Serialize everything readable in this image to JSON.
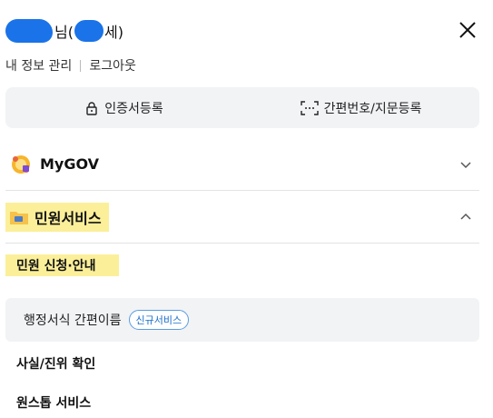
{
  "user": {
    "name_suffix": "님(",
    "name_suffix2": "세)"
  },
  "account": {
    "my_info": "내 정보 관리",
    "logout": "로그아웃"
  },
  "certificate": {
    "cert_register": "인증서등록",
    "pin_register": "간편번호/지문등록"
  },
  "menu": {
    "mygov": {
      "label": "MyGOV",
      "state": "collapsed"
    },
    "minwon": {
      "label": "민원서비스",
      "state": "expanded"
    }
  },
  "minwon_sub": {
    "apply": "민원 신청·안내",
    "promo_label": "행정서식 간편이름",
    "promo_badge": "신규서비스",
    "verify": "사실/진위 확인",
    "onestop": "원스톱 서비스"
  },
  "colors": {
    "highlight": "#fbef9a",
    "badge": "#1a6ec9",
    "panel_bg": "#f1f3f5",
    "redaction": "#1a73e8"
  }
}
